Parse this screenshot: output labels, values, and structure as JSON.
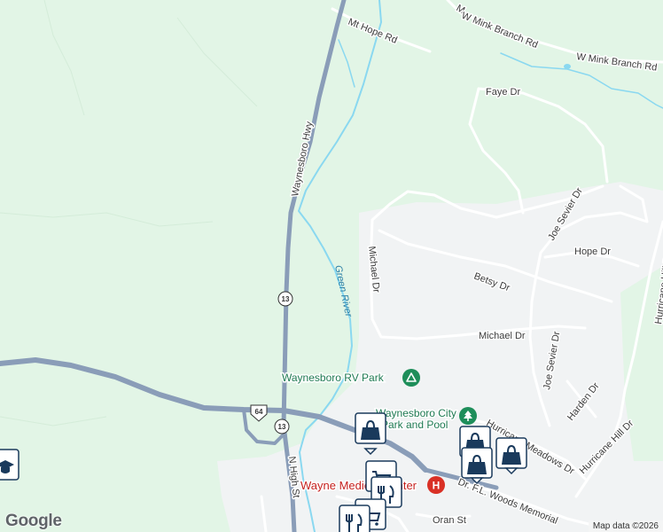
{
  "labels": {
    "highway": "Waynesboro Hwy",
    "mt_hope": "Mt Hope Rd",
    "w_mink_1": "W Mink Branch Rd",
    "w_mink_2": "W Mink Branch Rd",
    "faye": "Faye Dr",
    "joe_sevier_1": "Joe Sevier Dr",
    "joe_sevier_2": "Joe Sevier Dr",
    "hope": "Hope Dr",
    "hurricane_hill_1": "Hurricane Hill Dr",
    "hurricane_hill_2": "Hurricane Hill Dr",
    "michael_1": "Michael Dr",
    "michael_2": "Michael Dr",
    "betsy": "Betsy Dr",
    "harden": "Harden Dr",
    "hurricane_meadows": "Hurricane Meadows Dr",
    "n_high": "N High St",
    "oran": "Oran St",
    "memorial": "Dr. F.L. Woods Memorial",
    "top_road_partial": "M",
    "green_river": "Green River",
    "rv_park": "Waynesboro RV Park",
    "city_park_line1": "Waynesboro City",
    "city_park_line2": "Park and Pool",
    "hospital": "Wayne Medical Center"
  },
  "shields": {
    "state_route_a": "13",
    "state_route_b": "13",
    "us_route": "64"
  },
  "colors": {
    "forest": "#e2f5e6",
    "urban": "#f1f3f4",
    "highway": "#8a9db8",
    "water": "#8ad8f0",
    "local_road": "#ffffff",
    "park_icon": "#1e8e5a",
    "hospital": "#d93025",
    "shop_pin": "#1a3a5c"
  },
  "icons": [
    "shopping-bag-icon",
    "shopping-cart-icon",
    "restaurant-icon",
    "school-icon",
    "campground-icon",
    "tree-icon",
    "hospital-icon"
  ],
  "branding": {
    "logo": "Google",
    "attribution": "Map data ©2026"
  }
}
